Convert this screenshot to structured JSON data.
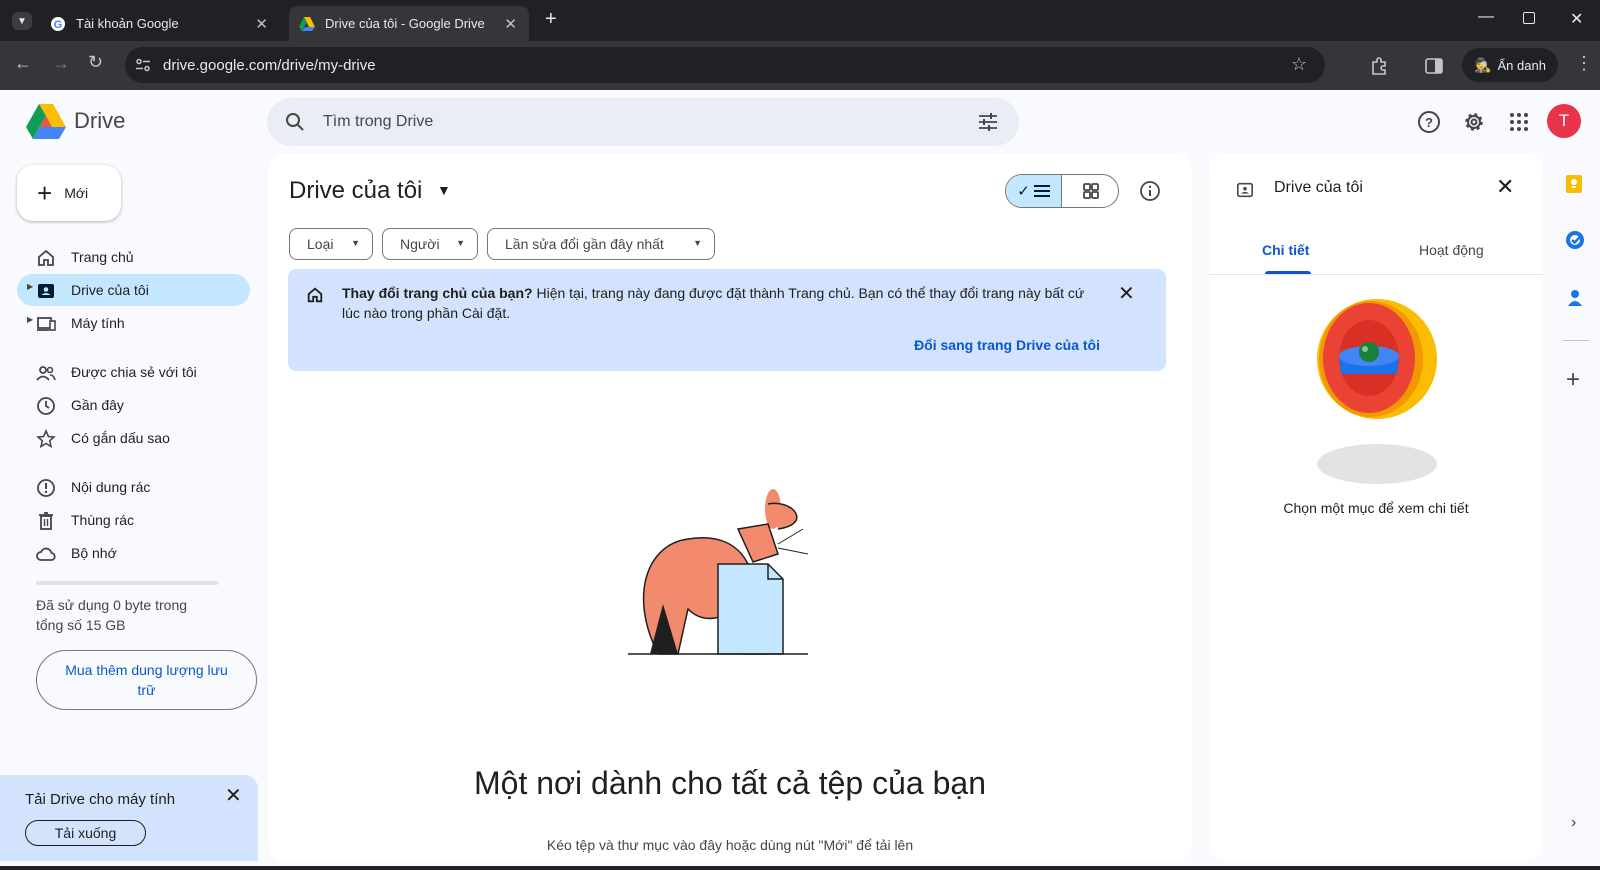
{
  "browser": {
    "tabs": [
      {
        "title": "Tài khoản Google"
      },
      {
        "title": "Drive của tôi - Google Drive"
      }
    ],
    "url": "drive.google.com/drive/my-drive",
    "incognito_label": "Ẩn danh"
  },
  "header": {
    "app_name": "Drive",
    "search_placeholder": "Tìm trong Drive",
    "avatar_letter": "T"
  },
  "sidebar": {
    "new_label": "Mới",
    "items": [
      {
        "label": "Trang chủ"
      },
      {
        "label": "Drive của tôi"
      },
      {
        "label": "Máy tính"
      },
      {
        "label": "Được chia sẻ với tôi"
      },
      {
        "label": "Gần đây"
      },
      {
        "label": "Có gắn dấu sao"
      },
      {
        "label": "Nội dung rác"
      },
      {
        "label": "Thùng rác"
      },
      {
        "label": "Bộ nhớ"
      }
    ],
    "storage_text": "Đã sử dụng 0 byte trong tổng số 15 GB",
    "buy_storage": "Mua thêm dung lượng lưu trữ",
    "download_card": {
      "title": "Tải Drive cho máy tính",
      "button": "Tải xuống"
    }
  },
  "main": {
    "title": "Drive của tôi",
    "filters": [
      "Loại",
      "Người",
      "Lần sửa đổi gần đây nhất"
    ],
    "banner": {
      "bold": "Thay đổi trang chủ của bạn?",
      "text": " Hiện tại, trang này đang được đặt thành Trang chủ. Bạn có thể thay đổi trang này bất cứ lúc nào trong phần Cài đặt.",
      "link": "Đổi sang trang Drive của tôi"
    },
    "empty_title": "Một nơi dành cho tất cả tệp của bạn",
    "empty_subtitle": "Kéo tệp và thư mục vào đây hoặc dùng nút \"Mới\" để tải lên"
  },
  "details": {
    "title": "Drive của tôi",
    "tabs": [
      "Chi tiết",
      "Hoạt động"
    ],
    "message": "Chọn một mục để xem chi tiết"
  },
  "colors": {
    "accent": "#0b57d0",
    "active_nav": "#c2e7ff",
    "banner_bg": "#d3e3fd",
    "avatar": "#e8334a"
  }
}
